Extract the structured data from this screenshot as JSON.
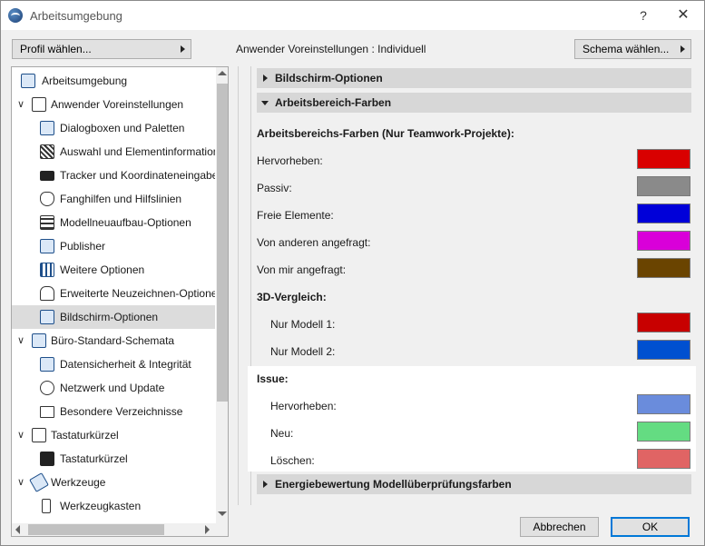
{
  "window": {
    "title": "Arbeitsumgebung",
    "help": "?",
    "close": "✕"
  },
  "toolbar": {
    "profile_label": "Profil wählen...",
    "user_settings": "Anwender Voreinstellungen :  Individuell",
    "schema_label": "Schema wählen..."
  },
  "tree": {
    "items": [
      {
        "label": "Arbeitsumgebung",
        "icon": "workspace-icon"
      },
      {
        "label": "Anwender Voreinstellungen",
        "icon": "user-settings-icon"
      },
      {
        "label": "Dialogboxen und Paletten",
        "icon": "dialog-palettes-icon"
      },
      {
        "label": "Auswahl und Elementinformation",
        "icon": "selection-info-icon"
      },
      {
        "label": "Tracker und Koordinateneingabe",
        "icon": "tracker-xyz-icon"
      },
      {
        "label": "Fanghilfen und Hilfslinien",
        "icon": "snap-guides-icon"
      },
      {
        "label": "Modellneuaufbau-Optionen",
        "icon": "model-rebuild-icon"
      },
      {
        "label": "Publisher",
        "icon": "publisher-icon"
      },
      {
        "label": "Weitere Optionen",
        "icon": "more-options-icon"
      },
      {
        "label": "Erweiterte Neuzeichnen-Optionen",
        "icon": "redraw-options-icon"
      },
      {
        "label": "Bildschirm-Optionen",
        "icon": "screen-options-icon"
      },
      {
        "label": "Büro-Standard-Schemata",
        "icon": "office-standard-icon"
      },
      {
        "label": "Datensicherheit & Integrität",
        "icon": "data-safety-icon"
      },
      {
        "label": "Netzwerk und Update",
        "icon": "network-icon"
      },
      {
        "label": "Besondere Verzeichnisse",
        "icon": "folder-icon"
      },
      {
        "label": "Tastaturkürzel",
        "icon": "shortcuts-icon"
      },
      {
        "label": "Tastaturkürzel",
        "icon": "shortcut-arrow-icon"
      },
      {
        "label": "Werkzeuge",
        "icon": "tools-icon"
      },
      {
        "label": "Werkzeugkasten",
        "icon": "toolbox-icon"
      }
    ]
  },
  "panel": {
    "section_screen": "Bildschirm-Optionen",
    "section_work": "Arbeitsbereich-Farben",
    "teamwork_heading": "Arbeitsbereichs-Farben (Nur Teamwork-Projekte):",
    "highlight": "Hervorheben:",
    "passive": "Passiv:",
    "free": "Freie Elemente:",
    "requested_others": "Von anderen angefragt:",
    "requested_me": "Von mir angefragt:",
    "compare_heading": "3D-Vergleich:",
    "model1": "Nur Modell 1:",
    "model2": "Nur Modell 2:",
    "issue_heading": "Issue:",
    "issue_highlight": "Hervorheben:",
    "issue_new": "Neu:",
    "issue_delete": "Löschen:",
    "section_energy": "Energiebewertung Modellüberprüfungsfarben"
  },
  "colors": {
    "highlight": "#d90000",
    "passive": "#8a8a8a",
    "free": "#0000d9",
    "requested_others": "#d900d9",
    "requested_me": "#6a4400",
    "model1": "#c80000",
    "model2": "#0050d0",
    "issue_highlight": "#6a8cdc",
    "issue_new": "#64dc82",
    "issue_delete": "#e06464"
  },
  "buttons": {
    "cancel": "Abbrechen",
    "ok": "OK"
  }
}
